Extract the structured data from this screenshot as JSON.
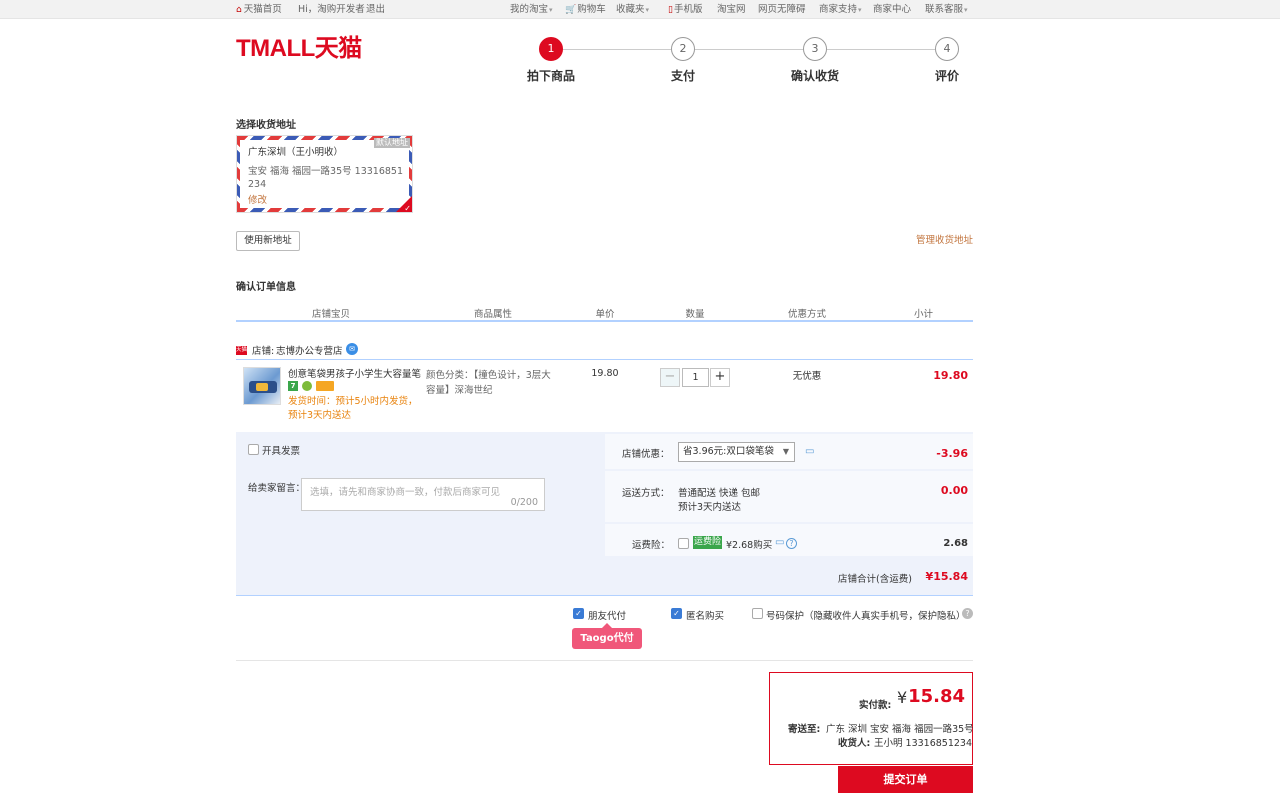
{
  "topbar": {
    "home": "天猫首页",
    "greeting": "Hi，淘购开发者",
    "logout": "退出",
    "my_taobao": "我的淘宝",
    "cart": "购物车",
    "favorites": "收藏夹",
    "mobile": "手机版",
    "taobao": "淘宝网",
    "accessible": "网页无障碍",
    "merchant_support": "商家支持",
    "merchant_center": "商家中心",
    "customer_service": "联系客服"
  },
  "logo": "TMALL天猫",
  "steps": [
    {
      "num": "1",
      "label": "拍下商品"
    },
    {
      "num": "2",
      "label": "支付"
    },
    {
      "num": "3",
      "label": "确认收货"
    },
    {
      "num": "4",
      "label": "评价"
    }
  ],
  "address": {
    "section_title": "选择收货地址",
    "name": "广东深圳（王小明收）",
    "default_tag": "默认地址",
    "detail": "宝安 福海 福园一路35号 13316851234",
    "edit": "修改",
    "new_address": "使用新地址",
    "manage": "管理收货地址"
  },
  "order": {
    "section_title": "确认订单信息",
    "headers": [
      "店铺宝贝",
      "商品属性",
      "单价",
      "数量",
      "优惠方式",
      "小计"
    ],
    "shop_badge": "天猫",
    "shop_label": "店铺:",
    "shop_name": "志博办公专营店",
    "item": {
      "title": "创意笔袋男孩子小学生大容量笔...",
      "ship_time": "发货时间：预计5小时内发货，预计3天内送达",
      "attr": "颜色分类：【撞色设计，3层大容量】深海世纪",
      "unit_price": "19.80",
      "quantity": "1",
      "discount": "无优惠",
      "subtotal": "19.80"
    }
  },
  "details": {
    "invoice": "开具发票",
    "message_label": "给卖家留言：",
    "message_placeholder": "选填，请先和商家协商一致，付款后商家可见",
    "message_count": "0/200",
    "shop_discount_label": "店铺优惠：",
    "shop_discount_select": "省3.96元:双口袋笔袋",
    "shop_discount_value": "-3.96",
    "shipping_label": "运送方式：",
    "shipping_method": "普通配送 快递 包邮",
    "shipping_eta": "预计3天内送达",
    "shipping_value": "0.00",
    "insurance_label": "运费险：",
    "insurance_badge": "运费险",
    "insurance_price": "¥2.68购买",
    "insurance_value": "2.68",
    "shop_total_label": "店铺合计(含运费)",
    "shop_total_value": "¥15.84"
  },
  "options": {
    "friend_pay": "朋友代付",
    "anonymous": "匿名购买",
    "number_protect": "号码保护（隐藏收件人真实手机号，保护隐私）",
    "taogo_badge": "Taogo代付"
  },
  "payment": {
    "label": "实付款:",
    "currency": "¥",
    "amount": "15.84",
    "ship_to_label": "寄送至:",
    "ship_to": "广东 深圳 宝安 福海 福园一路35号",
    "receiver_label": "收货人:",
    "receiver": "王小明 13316851234",
    "submit": "提交订单"
  },
  "colors": {
    "brand": "#dd0a20",
    "link": "#c2743d",
    "accent_blue": "#3a7bd5"
  }
}
